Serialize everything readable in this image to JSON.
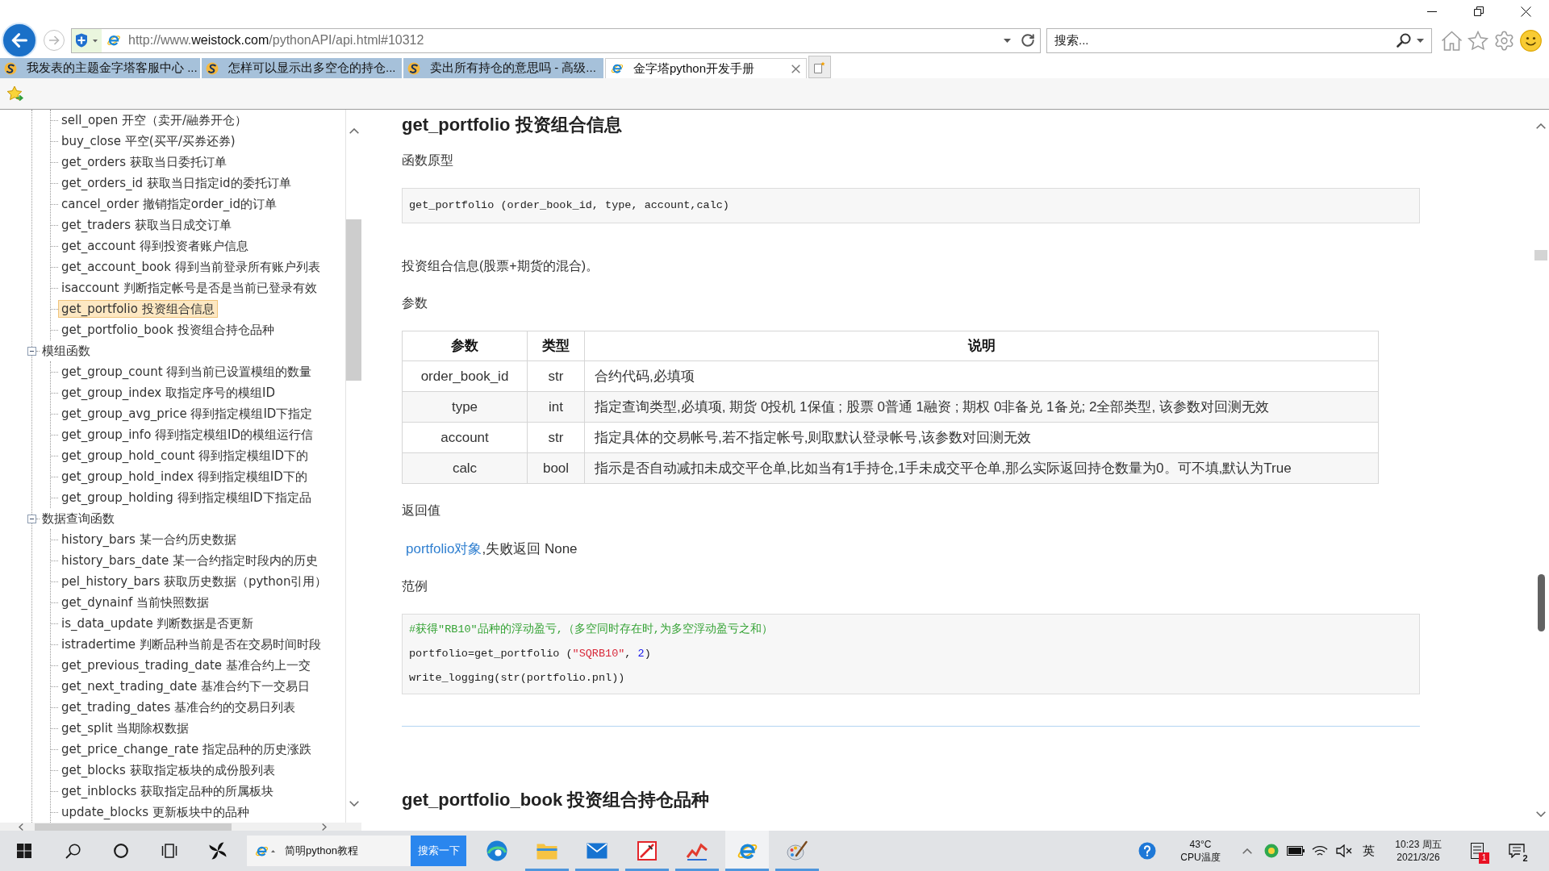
{
  "browser": {
    "url": {
      "scheme": "http://www.",
      "domain": "weistock.com",
      "path": "/pythonAPI/api.html#10312"
    },
    "search_placeholder": "搜索..."
  },
  "tabs": [
    {
      "kind": "forum",
      "title": "我发表的主题金字塔客服中心 ...",
      "selected": false
    },
    {
      "kind": "forum",
      "title": "怎样可以显示出多空仓的持仓...",
      "selected": false
    },
    {
      "kind": "forum",
      "title": "卖出所有持仓的意思吗 - 高级...",
      "selected": false
    },
    {
      "kind": "page",
      "title": "金字塔python开发手册",
      "selected": true
    }
  ],
  "sidebar": {
    "tree": [
      {
        "children": [
          {
            "label": "sell_open 开空（卖开/融券开仓）",
            "selected": false
          },
          {
            "label": "buy_close 平空(买平/买券还券)",
            "selected": false
          },
          {
            "label": "get_orders 获取当日委托订单",
            "selected": false
          },
          {
            "label": "get_orders_id 获取当日指定id的委托订单",
            "selected": false
          },
          {
            "label": "cancel_order 撤销指定order_id的订单",
            "selected": false
          },
          {
            "label": "get_traders 获取当日成交订单",
            "selected": false
          },
          {
            "label": "get_account 得到投资者账户信息",
            "selected": false
          },
          {
            "label": "get_account_book 得到当前登录所有账户列表",
            "selected": false
          },
          {
            "label": "isaccount 判断指定帐号是否是当前已登录有效",
            "selected": false
          },
          {
            "label": "get_portfolio 投资组合信息",
            "selected": true
          },
          {
            "label": "get_portfolio_book 投资组合持仓品种",
            "selected": false
          }
        ]
      },
      {
        "label": "模组函数",
        "expanded": true,
        "children": [
          {
            "label": "get_group_count 得到当前已设置模组的数量",
            "selected": false
          },
          {
            "label": "get_group_index 取指定序号的模组ID",
            "selected": false
          },
          {
            "label": "get_group_avg_price 得到指定模组ID下指定",
            "selected": false
          },
          {
            "label": "get_group_info 得到指定模组ID的模组运行信",
            "selected": false
          },
          {
            "label": "get_group_hold_count 得到指定模组ID下的",
            "selected": false
          },
          {
            "label": "get_group_hold_index 得到指定模组ID下的",
            "selected": false
          },
          {
            "label": "get_group_holding 得到指定模组ID下指定品",
            "selected": false
          }
        ]
      },
      {
        "label": "数据查询函数",
        "expanded": true,
        "children": [
          {
            "label": "history_bars 某一合约历史数据",
            "selected": false
          },
          {
            "label": "history_bars_date 某一合约指定时段内的历史",
            "selected": false
          },
          {
            "label": "pel_history_bars 获取历史数据（python引用）",
            "selected": false
          },
          {
            "label": "get_dynainf 当前快照数据",
            "selected": false
          },
          {
            "label": "is_data_update 判断数据是否更新",
            "selected": false
          },
          {
            "label": "istradertime 判断品种当前是否在交易时间时段",
            "selected": false
          },
          {
            "label": "get_previous_trading_date 基准合约上一交",
            "selected": false
          },
          {
            "label": "get_next_trading_date 基准合约下一交易日",
            "selected": false
          },
          {
            "label": "get_trading_dates 基准合约的交易日列表",
            "selected": false
          },
          {
            "label": "get_split 当期除权数据",
            "selected": false
          },
          {
            "label": "get_price_change_rate 指定品种的历史涨跌",
            "selected": false
          },
          {
            "label": "get_blocks 获取指定板块的成份股列表",
            "selected": false
          },
          {
            "label": "get_inblocks 获取指定品种的所属板块",
            "selected": false
          },
          {
            "label": "update_blocks 更新板块中的品种",
            "selected": false
          }
        ]
      }
    ]
  },
  "content": {
    "sections": [
      {
        "title": "get_portfolio 投资组合信息",
        "prototype_label": "函数原型",
        "prototype": "get_portfolio (order_book_id, type, account,calc)",
        "description": "投资组合信息(股票+期货的混合)。",
        "params_label": "参数",
        "params": {
          "columns": [
            "参数",
            "类型",
            "说明"
          ],
          "rows": [
            [
              "order_book_id",
              "str",
              "合约代码,必填项"
            ],
            [
              "type",
              "int",
              "指定查询类型,必填项, 期货 0投机 1保值 ; 股票 0普通 1融资 ; 期权 0非备兑 1备兑; 2全部类型, 该参数对回测无效"
            ],
            [
              "account",
              "str",
              "指定具体的交易帐号,若不指定帐号,则取默认登录帐号,该参数对回测无效"
            ],
            [
              "calc",
              "bool",
              "指示是否自动减扣未成交平仓单,比如当有1手持仓,1手未成交平仓单,那么实际返回持仓数量为0。可不填,默认为True"
            ]
          ]
        },
        "returns_label": "返回值",
        "returns": {
          "link": "portfolio对象",
          "text": ",失败返回 None"
        },
        "example_label": "范例",
        "example": [
          [
            {
              "kind": "comment",
              "text": "#获得\"RB10\"品种的浮动盈亏,（多空同时存在时,为多空浮动盈亏之和）"
            }
          ],
          [
            {
              "kind": "plain",
              "text": "portfolio=get_portfolio ("
            },
            {
              "kind": "string",
              "text": "\"SQRB10\""
            },
            {
              "kind": "plain",
              "text": ", "
            },
            {
              "kind": "number",
              "text": "2"
            },
            {
              "kind": "plain",
              "text": ")"
            }
          ],
          [
            {
              "kind": "plain",
              "text": "write_logging(str(portfolio.pnl))"
            }
          ]
        ]
      },
      {
        "title": "get_portfolio_book 投资组合持仓品种"
      }
    ]
  },
  "taskbar": {
    "search": {
      "value": "简明python教程",
      "button": "搜索一下"
    },
    "apps": [
      {
        "kind": "wave",
        "running": false,
        "selected": false
      },
      {
        "kind": "folder",
        "running": true,
        "selected": false
      },
      {
        "kind": "mail",
        "running": true,
        "selected": false
      },
      {
        "kind": "pen",
        "running": true,
        "selected": false
      },
      {
        "kind": "chart",
        "running": true,
        "selected": false
      },
      {
        "kind": "globe",
        "running": true,
        "selected": true
      },
      {
        "kind": "brush",
        "running": true,
        "selected": false
      }
    ],
    "temperature": {
      "value": "43°C",
      "label": "CPU温度"
    },
    "input_method": "英",
    "clock": {
      "time": "10:23 周五",
      "date": "2021/3/26"
    },
    "notification_badge": "1",
    "action_center_badge": "2"
  }
}
